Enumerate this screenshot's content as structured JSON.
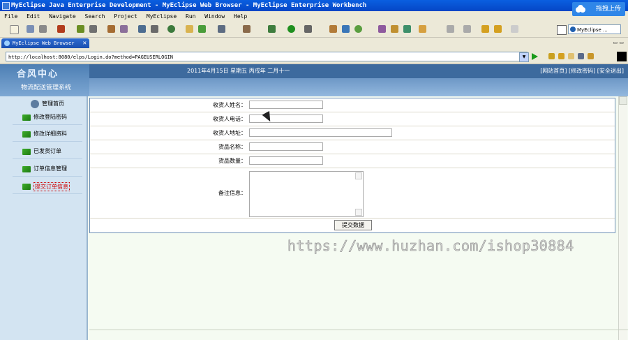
{
  "window": {
    "title": "MyEclipse Java Enterprise Development - MyEclipse Web Browser - MyEclipse Enterprise Workbench"
  },
  "upload_button": {
    "label": "拖拽上传"
  },
  "menu": [
    "File",
    "Edit",
    "Navigate",
    "Search",
    "Project",
    "MyEclipse",
    "Run",
    "Window",
    "Help"
  ],
  "perspective": {
    "label": "MyEclipse ..."
  },
  "tab": {
    "label": "MyEclipse Web Browser"
  },
  "address": {
    "url": "http://localhost:8080/elps/Login.do?method=PAGEUSERLOGIN"
  },
  "site": {
    "logo": "合风中心",
    "system_name": "物流配送管理系统",
    "date_text": "2011年4月15日 星期五 丙戌年 二月十一",
    "top_links": "[网站首页] [修改密码] [安全退出]"
  },
  "sidebar": {
    "header": "管理首页",
    "items": [
      {
        "label": "修改登陆密码"
      },
      {
        "label": "修改详细资料"
      },
      {
        "label": "已发货订单"
      },
      {
        "label": "订单信息管理"
      },
      {
        "label": "提交订单信息"
      }
    ]
  },
  "form": {
    "fields": [
      {
        "label": "收货人姓名：",
        "value": ""
      },
      {
        "label": "收货人电话：",
        "value": ""
      },
      {
        "label": "收货人地址：",
        "value": ""
      },
      {
        "label": "货品名称：",
        "value": ""
      },
      {
        "label": "货品数量：",
        "value": ""
      }
    ],
    "notes_label": "备注信息：",
    "notes_value": "",
    "submit_label": "提交数据"
  },
  "watermark": "https://www.huzhan.com/ishop30884",
  "colors": {
    "title_bar": "#0546c6",
    "site_header": "#3d6a9e",
    "sidebar_bg": "#d3e4f2",
    "active_item": "#d00000"
  }
}
